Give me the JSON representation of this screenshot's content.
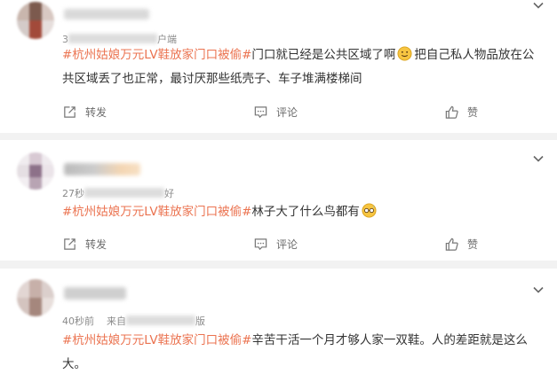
{
  "hashtag": "#杭州姑娘万元LV鞋放家门口被偷#",
  "accent_color": "#eb7350",
  "actions": {
    "share": "转发",
    "comment": "评论",
    "like": "赞"
  },
  "posts": [
    {
      "meta_prefix": "3",
      "meta_suffix": "户端",
      "text_before_emoji": "门口就已经是公共区域了啊",
      "emoji": "smile-emoji",
      "text_after_emoji": "把自己私人物品放在公共区域丢了也正常，最讨厌那些纸壳子、车子堆满楼梯间"
    },
    {
      "meta_prefix": "27秒",
      "meta_suffix": "好",
      "text": "林子大了什么鸟都有",
      "emoji": "sweat-glasses-emoji"
    },
    {
      "meta_prefix": "40秒前",
      "meta_mid": "来自",
      "meta_suffix": "版",
      "text": "辛苦干活一个月才够人家一双鞋。人的差距就是这么大。"
    }
  ]
}
